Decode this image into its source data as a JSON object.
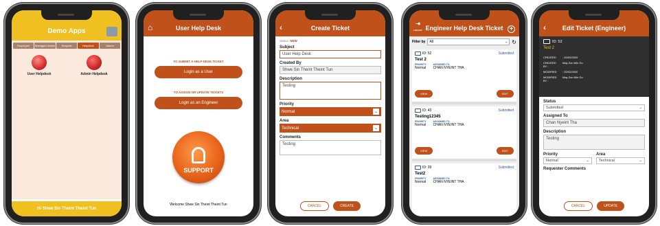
{
  "phone1": {
    "title": "Demo Apps",
    "tabs": [
      "Employee",
      "Manager/ Admin",
      "Request",
      "Helpdesk",
      "Others"
    ],
    "apps": [
      "User Helpdesk",
      "Admin Helpdesk"
    ],
    "footer": "Hi Shwe Sin Theint Theint Tun"
  },
  "phone2": {
    "title": "User Help Desk",
    "submit_label": "TO SUBMIT A HELP DESK TICKET",
    "user_button": "Login as a User",
    "assign_label": "TO ASSIGN OR UPDATE TICKETS",
    "engineer_button": "Login as an Engineer",
    "support_text": "SUPPORT",
    "welcome": "Welcome Shwe Sin Theint Theint Tun"
  },
  "phone3": {
    "title": "Create Ticket",
    "status_label": "Status:",
    "status_value": "NEW",
    "subject_label": "Subject",
    "subject_value": "User Help Desk",
    "created_by_label": "Created By",
    "created_by_value": "Shwe Sin Theint Theint Tun",
    "description_label": "Description",
    "description_value": "Testing",
    "priority_label": "Priority",
    "priority_value": "Normal",
    "area_label": "Area",
    "area_value": "Technical",
    "comments_label": "Comments",
    "comments_value": "Testing",
    "cancel": "CANCEL",
    "create": "CREATE"
  },
  "phone4": {
    "title": "Engineer Help Desk Ticket",
    "logout": "LOGOUT",
    "filter_label": "Filter by",
    "filter_value": "All",
    "priority_key": "PRIORITY",
    "assigned_key": "ASSIGNED TO",
    "view": "VIEW",
    "edit": "EDIT",
    "tickets": [
      {
        "id": "ID: 52",
        "status": "Submitted",
        "title": "Test 2",
        "priority": "Normal",
        "assigned": "CHAN NYEINT THA"
      },
      {
        "id": "ID: 43",
        "status": "Submitted",
        "title": "Testing12345",
        "priority": "Normal",
        "assigned": "CHAN NYEINT THA"
      },
      {
        "id": "ID: 39",
        "status": "Submitted",
        "title": "Test2",
        "priority": "Normal",
        "assigned": "CHAN NYEINT THA"
      }
    ]
  },
  "phone5": {
    "title": "Edit Ticket (Engineer)",
    "id": "ID: 52",
    "ticket_title": "Test 2",
    "created_key": "CREATED",
    "created_val": ": 20/02/2020",
    "created_by_key": "CREATED BY :",
    "created_by_val": "May Zon Min Oo",
    "modified_key": "MODIFIED",
    "modified_val": ": 20/02/2020",
    "modified_by_key": "MODIFIED BY :",
    "modified_by_val": "May Zon Min Oo",
    "status_label": "Status",
    "status_value": "Submitted",
    "assigned_label": "Assigned To",
    "assigned_value": "Chan Nyeint Tha",
    "description_label": "Description",
    "description_value": "Testing",
    "priority_label": "Priority",
    "priority_value": "Normal",
    "area_label": "Area",
    "area_value": "Technical",
    "requester_label": "Requester Comments",
    "cancel": "CANCEL",
    "update": "UPDATE"
  }
}
